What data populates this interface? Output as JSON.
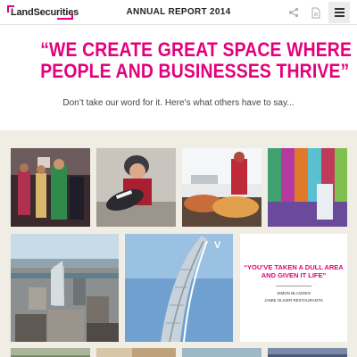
{
  "header": {
    "logo_text": "LandSecurities",
    "title": "ANNUAL REPORT 2014",
    "icons": [
      "share-icon",
      "document-icon",
      "menu-icon"
    ]
  },
  "hero": {
    "quote_line1": "“WE CREATE GREAT SPACE WHERE",
    "quote_line2": "PEOPLE AND BUSINESSES THRIVE”",
    "subtitle": "Don’t take our word for it. Here’s what others have to say..."
  },
  "testimonial": {
    "quote_line1": "“YOU’VE TAKEN A DULL AREA",
    "quote_line2": "AND GIVEN IT LIFE”",
    "name": "SIMON BLAGDEN",
    "organisation": "JAMIE OLIVER RESTAURANTS"
  },
  "colors": {
    "accent": "#e4007c",
    "gallery_background": "#f0eee4"
  }
}
